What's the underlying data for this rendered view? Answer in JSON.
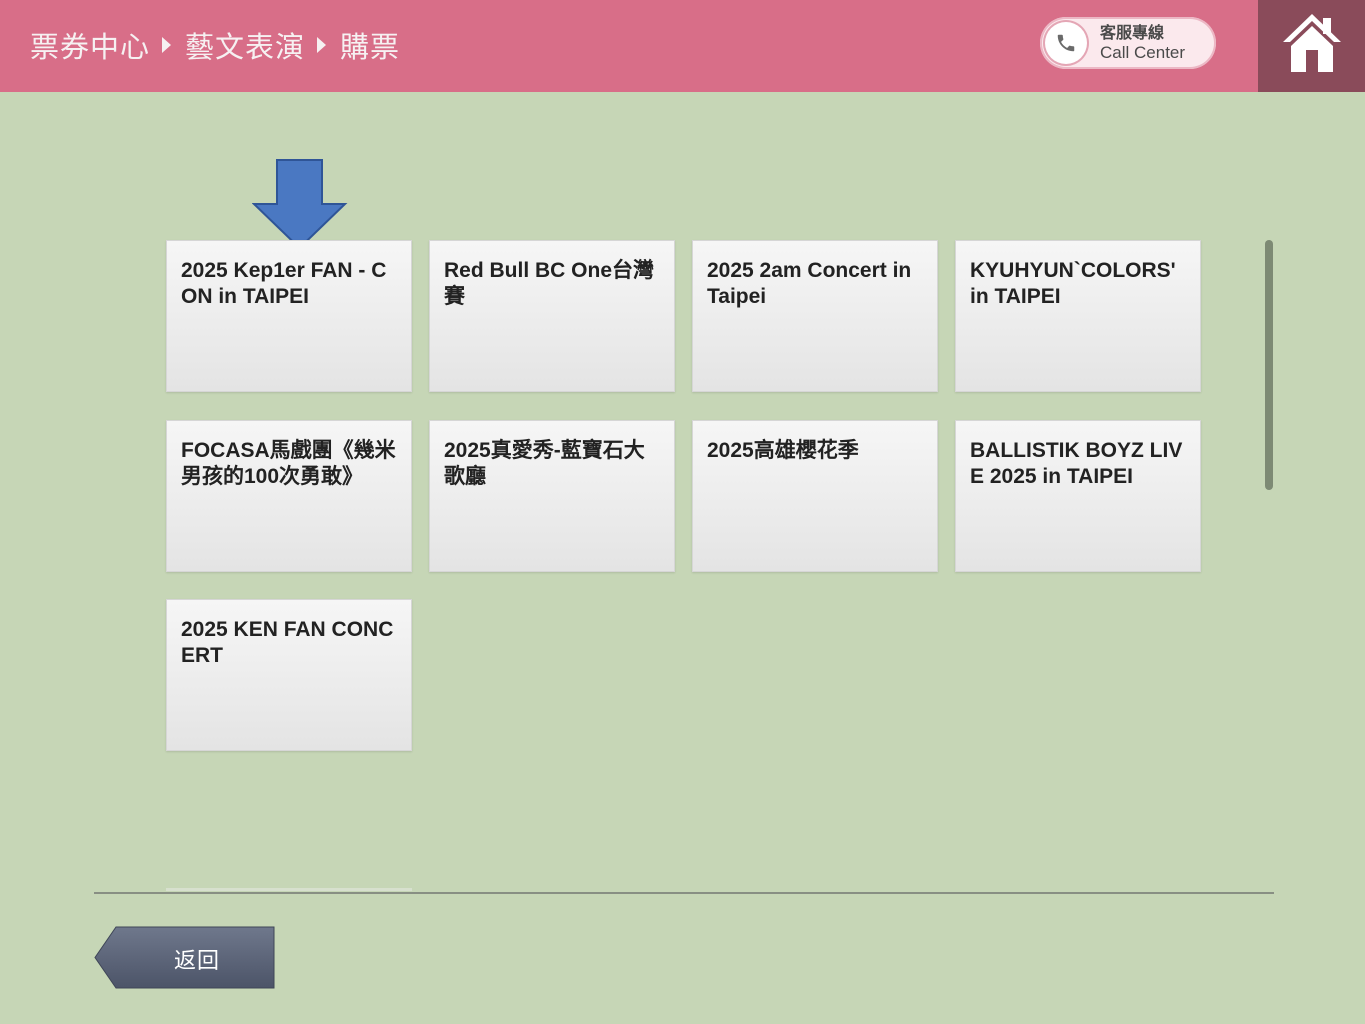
{
  "header": {
    "breadcrumb": [
      "票券中心",
      "藝文表演",
      "購票"
    ],
    "call_center": {
      "label_zh": "客服專線",
      "label_en": "Call Center"
    }
  },
  "events": [
    "2025 Kep1er FAN - CON in TAIPEI",
    "Red Bull BC One台灣賽",
    "2025 2am Concert in Taipei",
    "KYUHYUN`COLORS' in TAIPEI",
    "FOCASA馬戲團《幾米男孩的100次勇敢》",
    "2025真愛秀-藍寶石大歌廳",
    "2025高雄櫻花季",
    "BALLISTIK BOYZ LIVE 2025 in TAIPEI",
    "2025 KEN FAN CONCERT"
  ],
  "footer": {
    "back_label": "返回"
  },
  "colors": {
    "header_bg": "#d86e88",
    "home_bg": "#8a4b5a",
    "page_bg": "#c6d6b6",
    "marker_arrow": "#4a78c2",
    "back_button": "#5b6478"
  },
  "icons": {
    "home": "home-icon",
    "phone": "phone-icon",
    "marker": "down-arrow-icon"
  }
}
